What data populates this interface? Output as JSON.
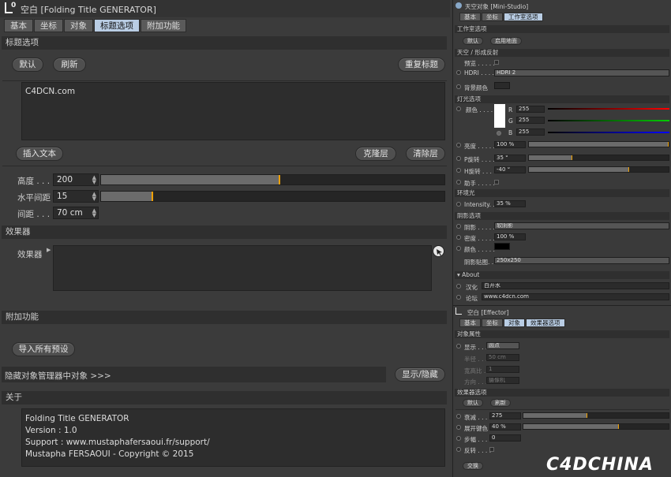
{
  "left": {
    "title": "空白 [Folding Title GENERATOR]",
    "tabs": [
      "基本",
      "坐标",
      "对象",
      "标题选项",
      "附加功能"
    ],
    "active_tab": 3,
    "sections": {
      "title_options": "标题选项",
      "effectors": "效果器",
      "extras": "附加功能",
      "about": "关于"
    },
    "buttons": {
      "default": "默认",
      "refresh": "刷新",
      "reset_title": "重复标题",
      "insert_text": "插入文本",
      "clone_layer": "克隆层",
      "clear_layer": "清除层",
      "import_presets": "导入所有预设",
      "show_hide": "显示/隐藏"
    },
    "text_value": "C4DCN.com",
    "params": {
      "height": {
        "label": "高度 . . .",
        "value": "200",
        "fraction": 0.52
      },
      "h_spacing": {
        "label": "水平间距",
        "value": "15",
        "fraction": 0.15
      },
      "spacing": {
        "label": "间距 . . .",
        "value": "70 cm"
      }
    },
    "effector_label": "效果器",
    "hide_objects_label": "隐藏对象管理器中对象   >>>",
    "about_lines": [
      "Folding Title GENERATOR",
      "Version : 1.0",
      "Support : www.mustaphafersaoui.fr/support/",
      "Mustapha FERSAOUI - Copyright © 2015"
    ]
  },
  "right": {
    "title": "天空对象 [Mini-Studio]",
    "tabs": [
      "基本",
      "坐标",
      "工作室选项"
    ],
    "active_tab": 2,
    "studio_section": "工作室选项",
    "studio_buttons": [
      "默认",
      "启用地面"
    ],
    "sky_section": "天空 / 形成反射",
    "preview_label": "预览 . . . . .",
    "hdri_label": "HDRI . . . . .",
    "hdri_value": "HDRI 2",
    "bg_color_label": "背景颜色",
    "light_section": "灯光选项",
    "color_label": "颜色 . . . . .",
    "rgb": [
      {
        "ch": "R",
        "value": "255"
      },
      {
        "ch": "G",
        "value": "255"
      },
      {
        "ch": "B",
        "value": "255"
      }
    ],
    "brightness": {
      "label": "亮度 . . . . .",
      "value": "100 %",
      "fraction": 1.0
    },
    "p_rot": {
      "label": "P旋转 . . . .",
      "value": "35 °",
      "fraction": 0.31
    },
    "h_rot": {
      "label": "H旋转 . . . .",
      "value": "-40 °",
      "fraction": 0.72
    },
    "helper_label": "助手 . . . . .",
    "ambient_section": "环境光",
    "intensity": {
      "label": "Intensity. . .",
      "value": "35 %"
    },
    "shadow_section": "阴影选项",
    "shadow_label": "阴影 . . . . .",
    "shadow_value": "软阴影",
    "density": {
      "label": "密度 . . . . .",
      "value": "100 %"
    },
    "shadow_color_label": "颜色 . . . . .",
    "shadow_map_label": "阴影贴图. . .",
    "shadow_map_value": "250x250",
    "about_section": "About",
    "hanhua_label": "汉化",
    "hanhua_value": "白开水",
    "forum_label": "论坛",
    "forum_value": "www.c4dcn.com",
    "effector_title": "空白 [Effector]",
    "effector_tabs": [
      "基本",
      "坐标",
      "对象",
      "效果器选项"
    ],
    "effector_active_tab": 2,
    "obj_props_section": "对象属性",
    "display_label": "显示 . . . .",
    "display_value": "圆点",
    "radius_label": "半径 . . . .",
    "radius_value": "50 cm",
    "aspect_label": "宽高比 . . .",
    "aspect_value": "1",
    "orient_label": "方向 . . . .",
    "orient_value": "摄像机",
    "eff_opts_section": "效果器选项",
    "eff_buttons": [
      "默认",
      "刷新"
    ],
    "decay": {
      "label": "衰减 . . . .",
      "value": "275",
      "fraction": 0.44
    },
    "unfold": {
      "label": "展开键色",
      "value": "40 %",
      "fraction": 0.66
    },
    "step_label": "步幅 . . . .",
    "step_value": "0",
    "flip_label": "反转 . . . .",
    "footer_btn": "交换",
    "watermark": "C4DCHINA"
  }
}
